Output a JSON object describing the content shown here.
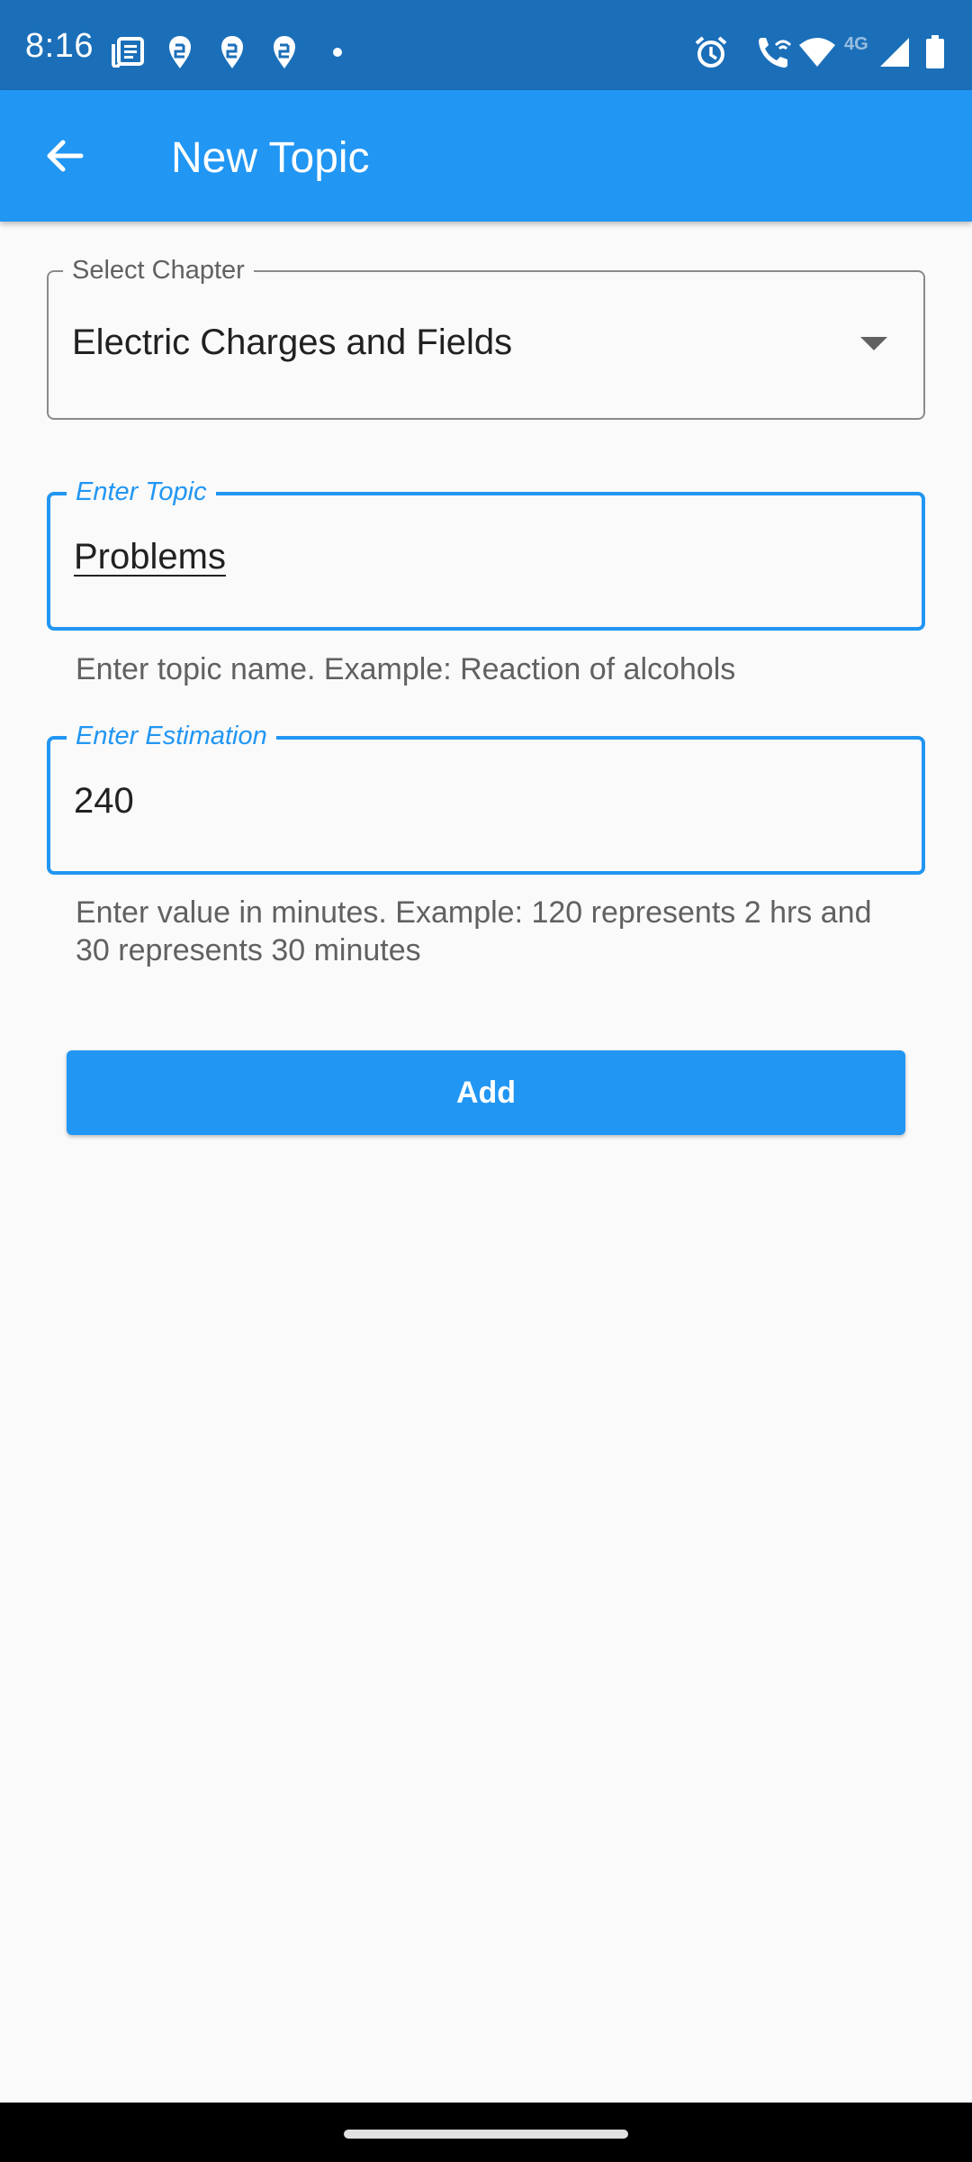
{
  "status_bar": {
    "time": "8:16",
    "network_label": "4G",
    "icons": [
      "news-icon",
      "swiggy-icon",
      "swiggy-icon",
      "swiggy-icon",
      "dot-icon",
      "alarm-icon",
      "wifi-call-icon",
      "wifi-icon",
      "signal-icon",
      "battery-icon"
    ]
  },
  "app_bar": {
    "title": "New Topic",
    "back_icon": "arrow-back-icon",
    "color": "#2196f3"
  },
  "form": {
    "chapter": {
      "label": "Select Chapter",
      "value": "Electric Charges and Fields"
    },
    "topic": {
      "label": "Enter Topic",
      "value": "Problems",
      "helper": "Enter topic name. Example: Reaction of alcohols"
    },
    "estimation": {
      "label": "Enter Estimation",
      "value": "240",
      "helper": "Enter value in minutes. Example: 120 represents 2 hrs and 30 represents 30 minutes"
    },
    "submit_label": "Add"
  }
}
